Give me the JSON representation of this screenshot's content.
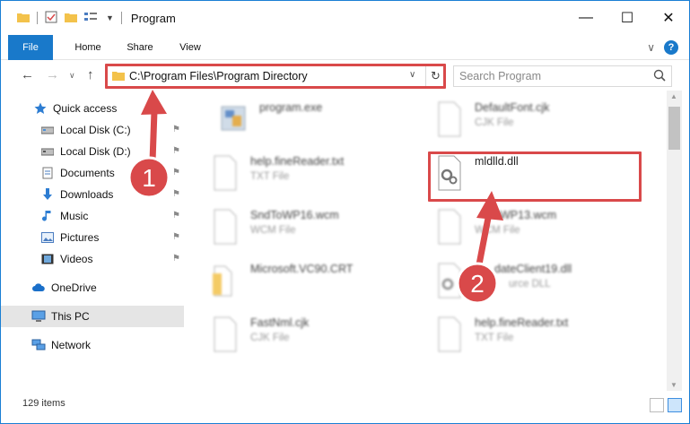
{
  "window": {
    "title": "Program",
    "minimize_label": "—",
    "maximize_label": "☐",
    "close_label": "✕"
  },
  "ribbon": {
    "tabs": [
      "File",
      "Home",
      "Share",
      "View"
    ],
    "expand_label": "∨",
    "help_label": "?"
  },
  "nav": {
    "back_label": "←",
    "forward_label": "→",
    "recent_label": "∨",
    "up_label": "↑",
    "address": "C:\\Program Files\\Program Directory",
    "address_dropdown": "∨",
    "refresh_label": "↻",
    "search_placeholder": "Search Program"
  },
  "sidebar": {
    "items": [
      {
        "label": "Quick access",
        "icon": "star-icon",
        "pinned": false
      },
      {
        "label": "Local Disk (C:)",
        "icon": "drive-icon",
        "pinned": true
      },
      {
        "label": "Local Disk (D:)",
        "icon": "drive-icon",
        "pinned": true
      },
      {
        "label": "Documents",
        "icon": "documents-icon",
        "pinned": true
      },
      {
        "label": "Downloads",
        "icon": "download-icon",
        "pinned": true
      },
      {
        "label": "Music",
        "icon": "music-icon",
        "pinned": true
      },
      {
        "label": "Pictures",
        "icon": "pictures-icon",
        "pinned": true
      },
      {
        "label": "Videos",
        "icon": "video-icon",
        "pinned": true
      },
      {
        "label": "OneDrive",
        "icon": "cloud-icon",
        "pinned": false
      },
      {
        "label": "This PC",
        "icon": "computer-icon",
        "pinned": false
      },
      {
        "label": "Network",
        "icon": "network-icon",
        "pinned": false
      }
    ],
    "pin_glyph": "⚑"
  },
  "files": [
    {
      "name": "program.exe",
      "type": ""
    },
    {
      "name": "DefaultFont.cjk",
      "type": "CJK File"
    },
    {
      "name": "help.fineReader.txt",
      "type": "TXT File"
    },
    {
      "name": "mldlld.dll",
      "type": ""
    },
    {
      "name": "SndToWP16.wcm",
      "type": "WCM File"
    },
    {
      "name": "WP13.wcm",
      "type": "WCM File"
    },
    {
      "name": "Microsoft.VC90.CRT",
      "type": ""
    },
    {
      "name": "dateClient19.dll",
      "type": "urce DLL"
    },
    {
      "name": "FastNml.cjk",
      "type": "CJK File"
    },
    {
      "name": "help.fineReader.txt",
      "type": "TXT File"
    }
  ],
  "status": {
    "count": "129 items"
  },
  "annotations": {
    "step1": "1",
    "step2": "2",
    "color": "#d9494a"
  },
  "colors": {
    "accent": "#1979ca",
    "highlight": "#d9494a",
    "folder": "#f3c24b"
  }
}
